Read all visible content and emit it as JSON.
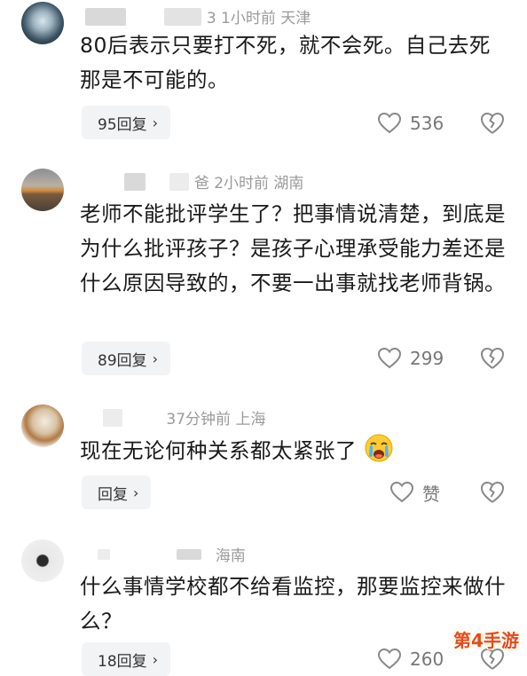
{
  "comments": [
    {
      "meta": "3  1小时前  天津",
      "text": "80后表示只要打不死，就不会死。自己去死那是不可能的。",
      "reply_label": "95回复",
      "likes": "536"
    },
    {
      "meta": "爸  2小时前  湖南",
      "text": "老师不能批评学生了？把事情说清楚，到底是为什么批评孩子？是孩子心理承受能力差还是什么原因导致的，不要一出事就找老师背锅。",
      "reply_label": "89回复",
      "likes": "299"
    },
    {
      "meta": "37分钟前  上海",
      "text": "现在无论何种关系都太紧张了",
      "reply_label": "回复",
      "likes": "赞"
    },
    {
      "meta": "海南",
      "text": "什么事情学校都不给看监控，那要监控来做什么？",
      "reply_label": "18回复",
      "likes": "260"
    }
  ],
  "watermark": "第4手游",
  "icons": {
    "reply_chevron": "chevron-right-icon",
    "like": "heart-outline-icon",
    "dislike": "broken-heart-icon",
    "emoji": "crying-face-emoji"
  }
}
